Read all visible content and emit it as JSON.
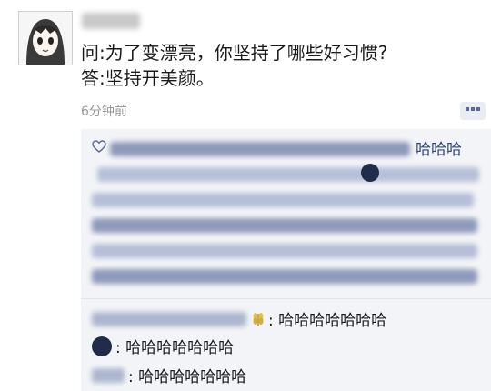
{
  "post": {
    "question": "问:为了变漂亮，你坚持了哪些好习惯?",
    "answer": "答:坚持开美颜。",
    "time": "6分钟前"
  },
  "likes": {
    "visible_fragments": [
      "哈哈哈"
    ]
  },
  "comments": [
    {
      "text": ": 哈哈哈哈哈哈哈"
    },
    {
      "text": ": 哈哈哈哈哈哈哈"
    },
    {
      "text": ": 哈哈哈哈哈哈哈"
    }
  ],
  "colors": {
    "accent": "#2f4477",
    "panel": "#f2f4f7"
  }
}
